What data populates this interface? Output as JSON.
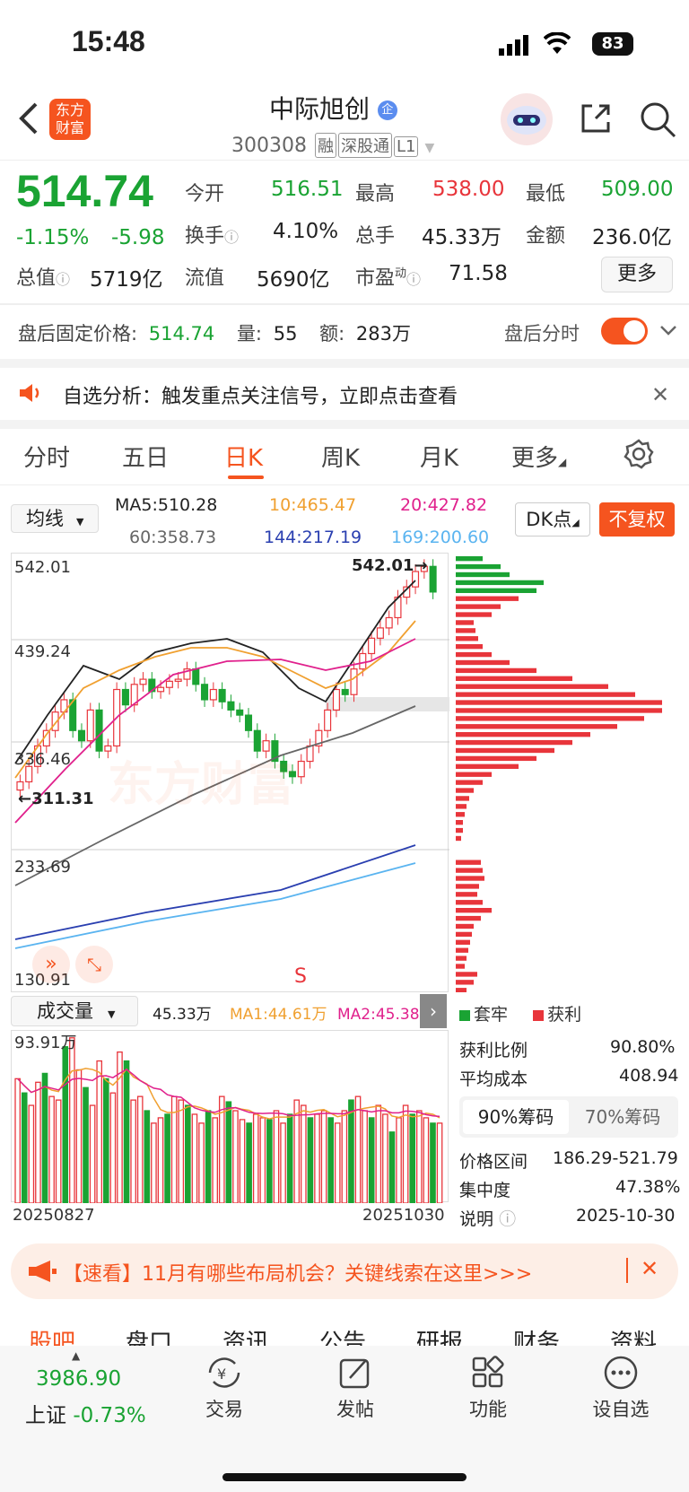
{
  "status": {
    "time": "15:48",
    "battery": "83"
  },
  "header": {
    "logo_line1": "东方",
    "logo_line2": "财富",
    "name": "中际旭创",
    "name_badge": "企",
    "code": "300308",
    "tags": [
      "融",
      "深股通",
      "L1"
    ]
  },
  "quote": {
    "price": "514.74",
    "change_pct": "-1.15%",
    "change": "-5.98",
    "open_label": "今开",
    "open": "516.51",
    "high_label": "最高",
    "high": "538.00",
    "low_label": "最低",
    "low": "509.00",
    "turnover_label": "换手",
    "turnover": "4.10%",
    "volume_label": "总手",
    "volume": "45.33万",
    "amount_label": "金额",
    "amount": "236.0亿",
    "mktcap_label": "总值",
    "mktcap": "5719亿",
    "float_label": "流值",
    "float": "5690亿",
    "pe_label": "市盈",
    "pe_sup": "动",
    "pe": "71.58",
    "more_label": "更多"
  },
  "afterhours": {
    "label": "盘后固定价格:",
    "price": "514.74",
    "vol_label": "量:",
    "vol": "55",
    "amt_label": "额:",
    "amt": "283万",
    "toggle_label": "盘后分时"
  },
  "notice": {
    "text": "自选分析：触发重点关注信号，立即点击查看"
  },
  "tabs": [
    "分时",
    "五日",
    "日K",
    "周K",
    "月K",
    "更多"
  ],
  "active_tab": "日K",
  "ma": {
    "selector": "均线",
    "ma5": "MA5:510.28",
    "ma10": "10:465.47",
    "ma20": "20:427.82",
    "ma60": "60:358.73",
    "ma144": "144:217.19",
    "ma169": "169:200.60",
    "dk": "DK点",
    "fq": "不复权",
    "colors": {
      "ma5": "#222222",
      "ma10": "#f0a030",
      "ma20": "#e0208c",
      "ma60": "#666666",
      "ma144": "#2a3fb0",
      "ma169": "#5ab4f0"
    }
  },
  "kline": {
    "y_labels": [
      "542.01",
      "439.24",
      "336.46",
      "233.69",
      "130.91"
    ],
    "max_marker": "542.01",
    "min_marker": "311.31",
    "s_label": "S",
    "watermark": "东方财富"
  },
  "volume_panel": {
    "selector": "成交量",
    "vol": "45.33万",
    "ma1": "MA1:44.61万",
    "ma2": "MA2:45.38万",
    "max": "93.91万",
    "date_start": "20250827",
    "date_end": "20251030"
  },
  "chips": {
    "legend_hold": "套牢",
    "legend_profit": "获利",
    "profit_ratio_label": "获利比例",
    "profit_ratio": "90.80%",
    "avg_cost_label": "平均成本",
    "avg_cost": "408.94",
    "tab90": "90%筹码",
    "tab70": "70%筹码",
    "range_label": "价格区间",
    "range": "186.29-521.79",
    "conc_label": "集中度",
    "conc": "47.38%",
    "note_label": "说明",
    "note": "2025-10-30"
  },
  "banner": {
    "text": "【速看】11月有哪些布局机会？关键线索在这里>>>"
  },
  "subtabs": [
    "股吧",
    "盘口",
    "资讯",
    "公告",
    "研报",
    "财务",
    "资料"
  ],
  "bottom": {
    "index_value": "3986.90",
    "index_name": "上证",
    "index_change": "-0.73%",
    "trade": "交易",
    "post": "发帖",
    "func": "功能",
    "watch": "设自选"
  },
  "chart_data": {
    "type": "bar",
    "title": "",
    "ylim": [
      0,
      93.91
    ],
    "series": [
      {
        "values": [
          70,
          62,
          55,
          68,
          73,
          60,
          58,
          88,
          93,
          75,
          65,
          55,
          80,
          70,
          62,
          85,
          80,
          58,
          60,
          52,
          45,
          48,
          50,
          60,
          58,
          55,
          50,
          45,
          52,
          48,
          60,
          57,
          52,
          47,
          45,
          50,
          48,
          47,
          52,
          45,
          50,
          58,
          55,
          48,
          50,
          52,
          48,
          45,
          52,
          58,
          60,
          52,
          48,
          55,
          50,
          40,
          48,
          55,
          50,
          52,
          48,
          45,
          45
        ]
      }
    ]
  }
}
